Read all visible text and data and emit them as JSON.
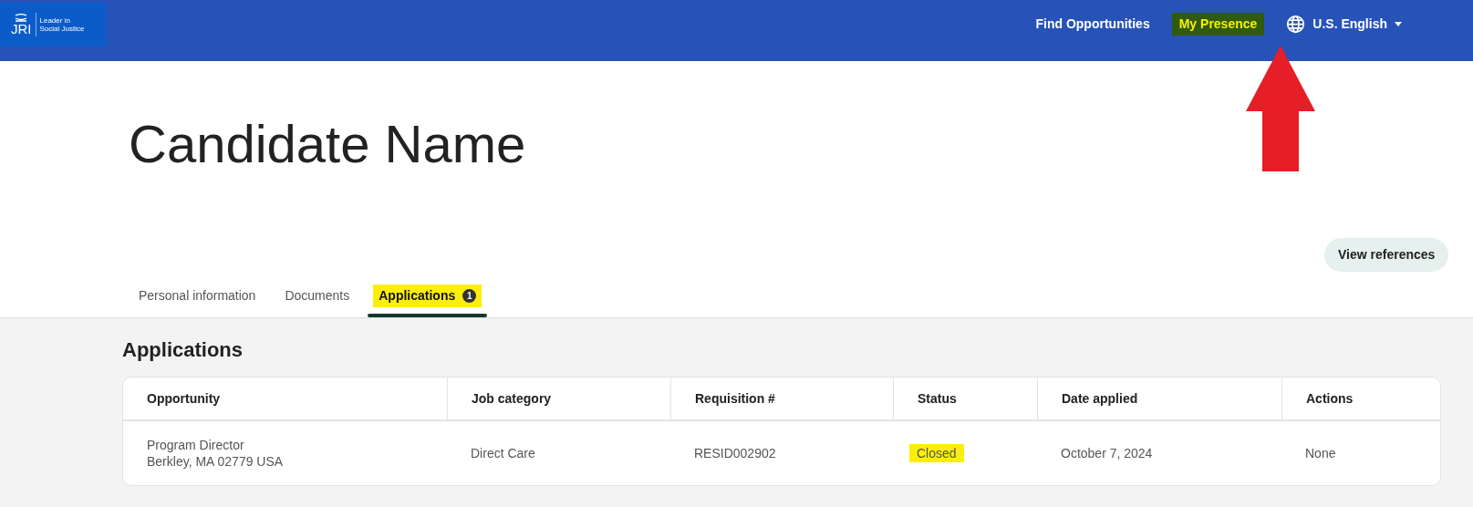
{
  "header": {
    "logo": {
      "mark": "JRI",
      "tagline_1": "Leader in",
      "tagline_2": "Social Justice"
    },
    "nav": [
      {
        "label": "Find Opportunities",
        "highlighted": false
      },
      {
        "label": "My Presence",
        "highlighted": true
      }
    ],
    "language": "U.S. English"
  },
  "profile": {
    "name": "Candidate Name",
    "button": "View references"
  },
  "tabs": [
    {
      "label": "Personal information",
      "selected": false,
      "highlighted": false
    },
    {
      "label": "Documents",
      "selected": false,
      "highlighted": false
    },
    {
      "label": "Applications",
      "selected": true,
      "highlighted": true,
      "badge": "1"
    }
  ],
  "section_title": "Applications",
  "table": {
    "columns": [
      "Opportunity",
      "Job category",
      "Requisition #",
      "Status",
      "Date applied",
      "Actions"
    ],
    "rows": [
      {
        "opportunity": "Program Director",
        "location": "Berkley, MA 02779 USA",
        "job_category": "Direct Care",
        "requisition": "RESID002902",
        "status": "Closed",
        "status_highlighted": true,
        "date_applied": "October 7, 2024",
        "actions": "None"
      }
    ]
  }
}
